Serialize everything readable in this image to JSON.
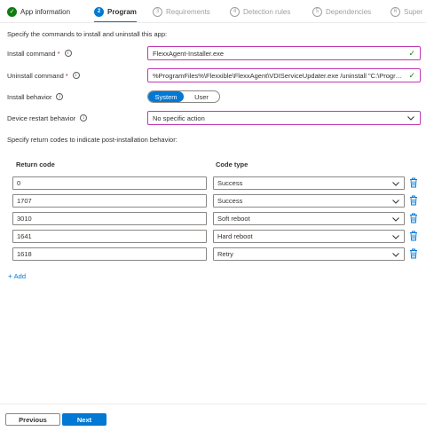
{
  "wizard": {
    "steps": [
      {
        "number": "",
        "label": "App information",
        "state": "done"
      },
      {
        "number": "2",
        "label": "Program",
        "state": "active"
      },
      {
        "number": "3",
        "label": "Requirements",
        "state": "pending"
      },
      {
        "number": "4",
        "label": "Detection rules",
        "state": "pending"
      },
      {
        "number": "5",
        "label": "Dependencies",
        "state": "pending"
      },
      {
        "number": "6",
        "label": "Super",
        "state": "pending"
      }
    ]
  },
  "form": {
    "intro": "Specify the commands to install and uninstall this app:",
    "install_command": {
      "label": "Install command",
      "required_mark": "*",
      "value": "FlexxAgent-Installer.exe"
    },
    "uninstall_command": {
      "label": "Uninstall command",
      "required_mark": "*",
      "value": "%ProgramFiles%\\Flexxible\\FlexxAgent\\VDIServiceUpdater.exe /uninstall \"C:\\Program Files\\Flexxible\\FlexxAgent\\FlexxAgent.exe\""
    },
    "install_behavior": {
      "label": "Install behavior",
      "options": [
        "System",
        "User"
      ],
      "selected": "System"
    },
    "device_restart": {
      "label": "Device restart behavior",
      "value": "No specific action"
    }
  },
  "return_codes": {
    "intro": "Specify return codes to indicate post-installation behavior:",
    "col_code": "Return code",
    "col_type": "Code type",
    "rows": [
      {
        "code": "0",
        "type": "Success"
      },
      {
        "code": "1707",
        "type": "Success"
      },
      {
        "code": "3010",
        "type": "Soft reboot"
      },
      {
        "code": "1641",
        "type": "Hard reboot"
      },
      {
        "code": "1618",
        "type": "Retry"
      }
    ],
    "add_label": "Add"
  },
  "footer": {
    "previous_label": "Previous",
    "next_label": "Next"
  },
  "colors": {
    "accent": "#0078d4",
    "success": "#107c10",
    "required": "#a4262c",
    "highlight_border": "#c239b3"
  }
}
